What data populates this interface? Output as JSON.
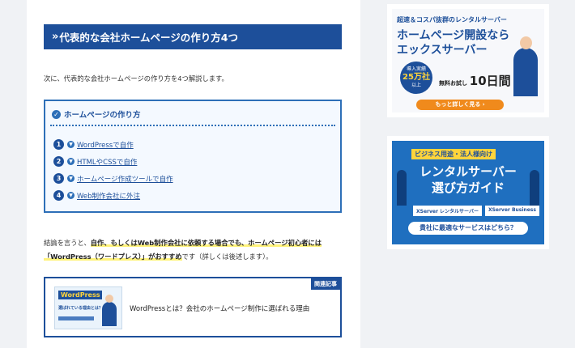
{
  "heading": {
    "chevron": "»",
    "title": "代表的な会社ホームページの作り方4つ"
  },
  "intro": "次に、代表的な会社ホームページの作り方を4つ解説します。",
  "toc": {
    "title": "ホームページの作り方",
    "items": [
      {
        "num": "1",
        "label": "WordPressで自作"
      },
      {
        "num": "2",
        "label": "HTMLやCSSで自作"
      },
      {
        "num": "3",
        "label": "ホームページ作成ツールで自作"
      },
      {
        "num": "4",
        "label": "Web制作会社に外注"
      }
    ]
  },
  "conclusion": {
    "lead": "結論を言うと、",
    "highlight1": "自作、もしくはWeb制作会社に依頼する場合でも、ホームページ初心者には「WordPress（ワードプレス）」がおすすめ",
    "tail": "です（詳しくは後述します）。"
  },
  "related": {
    "tag": "関連記事",
    "thumb_title": "WordPress",
    "thumb_sub": "選ばれている理由とは？",
    "title": "WordPressとは？会社のホームページ制作に選ばれる理由"
  },
  "ad1": {
    "top": "超速＆コスパ抜群のレンタルサーバー",
    "main1": "ホームページ開設なら",
    "main2": "エックスサーバー",
    "badge_top": "導入実績",
    "badge_num": "25万社",
    "badge_bottom": "以上",
    "trial_prefix": "無料お試し",
    "trial_days": "10日間",
    "button": "もっと詳しく見る ›"
  },
  "ad2": {
    "top": "ビジネス用途・法人様向け",
    "main1": "レンタルサーバー",
    "main2": "選び方ガイド",
    "pill1": "XServer レンタルサーバー",
    "pill2": "XServer Business",
    "button": "貴社に最適なサービスはどちら？"
  }
}
